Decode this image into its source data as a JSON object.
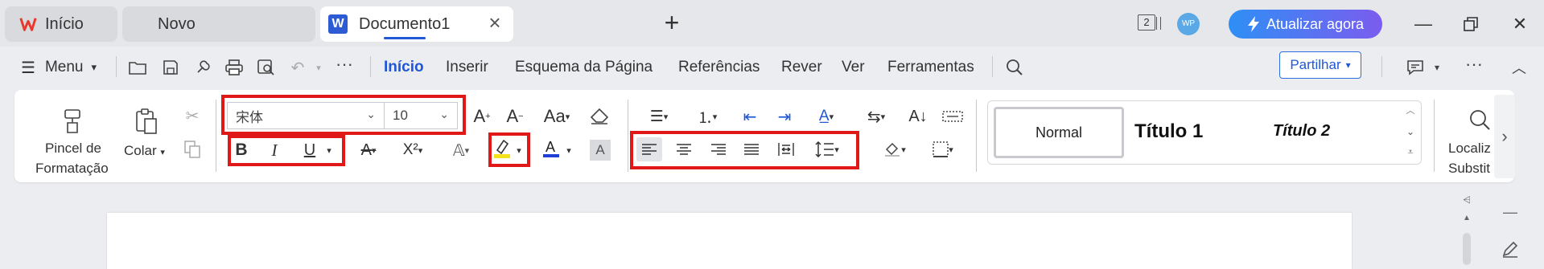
{
  "tabs": {
    "home": "Início",
    "novo": "Novo",
    "doc": "Documento1",
    "doc_icon_letter": "W",
    "new_tab_icon": "plus-icon",
    "close_icon": "close-icon"
  },
  "titlebar": {
    "window_count": "2",
    "avatar_text": "WP",
    "upgrade_label": "Atualizar agora",
    "upgrade_gradient": [
      "#2e8ff5",
      "#7b5cf0"
    ]
  },
  "menubar": {
    "menu_label": "Menu",
    "tabs": [
      "Início",
      "Inserir",
      "Esquema da Página",
      "Referências",
      "Rever",
      "Ver",
      "Ferramentas"
    ],
    "active_tab": "Início",
    "share_label": "Partilhar",
    "accent_color": "#1f57d6"
  },
  "ribbon": {
    "format_painter_line1": "Pincel de",
    "format_painter_line2": "Formatação",
    "paste_label": "Colar",
    "font_name": "宋体",
    "font_size": "10",
    "styles": {
      "normal": "Normal",
      "title1": "Título 1",
      "title2": "Título 2"
    },
    "find_line1": "Localiz",
    "find_line2": "Substit",
    "highlight_color": "#f3e21a",
    "font_color": "#1f3fd6",
    "annotation_color": "#e01818"
  }
}
